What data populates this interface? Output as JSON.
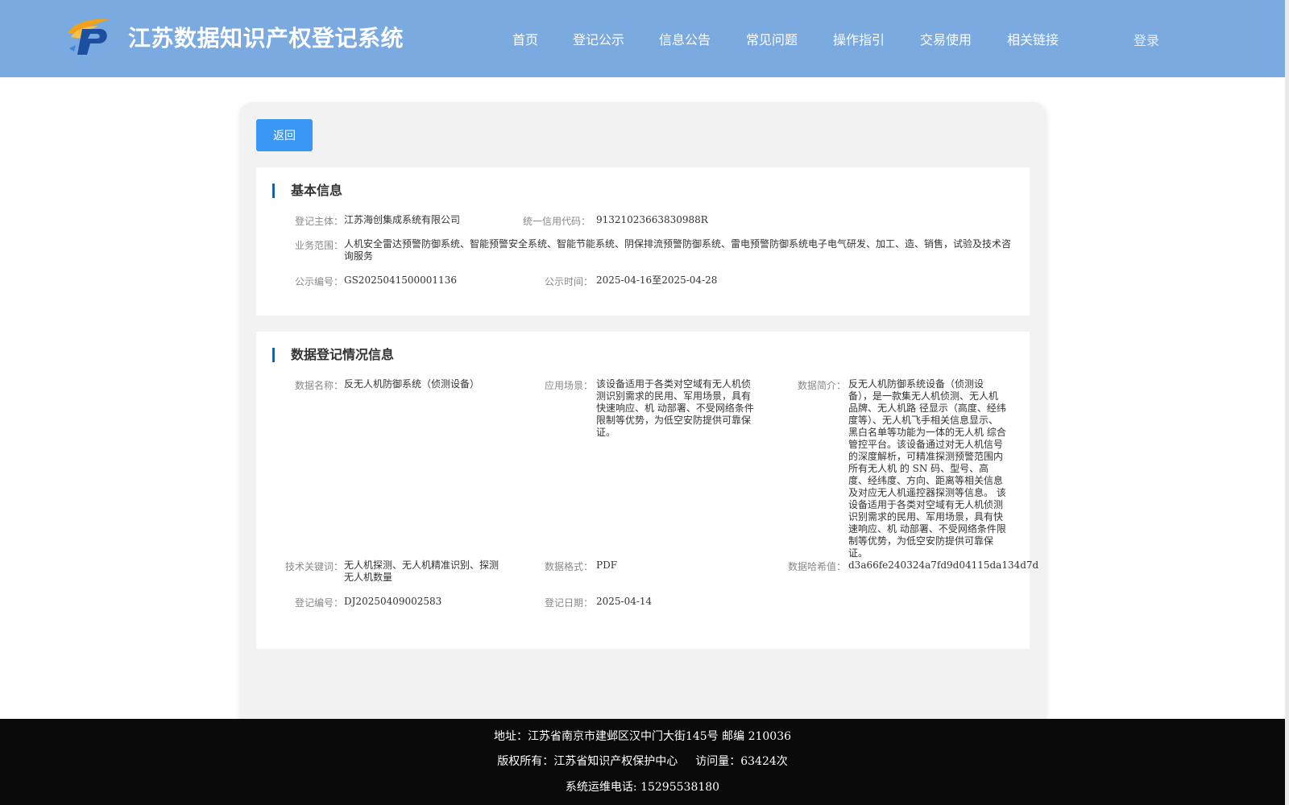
{
  "header": {
    "title": "江苏数据知识产权登记系统",
    "nav": [
      "首页",
      "登记公示",
      "信息公告",
      "常见问题",
      "操作指引",
      "交易使用",
      "相关链接"
    ],
    "login": "登录"
  },
  "back_label": "返回",
  "basic": {
    "title": "基本信息",
    "subject_label": "登记主体：",
    "subject": "江苏海创集成系统有限公司",
    "credit_label": "统一信用代码：",
    "credit": "91321023663830988R",
    "scope_label": "业务范围：",
    "scope": "人机安全雷达预警防御系统、智能预警安全系统、智能节能系统、阴保排流预警防御系统、雷电预警防御系统电子电气研发、加工、造、销售，试验及技术咨询服务",
    "notice_no_label": "公示编号：",
    "notice_no": "GS2025041500001136",
    "notice_time_label": "公示时间：",
    "notice_time": "2025-04-16至2025-04-28"
  },
  "data_info": {
    "title": "数据登记情况信息",
    "name_label": "数据名称：",
    "name": "反无人机防御系统（侦测设备）",
    "scene_label": "应用场景：",
    "scene": "该设备适用于各类对空域有无人机侦测识别需求的民用、军用场景，具有快速响应、机 动部署、不受网络条件限制等优势，为低空安防提供可靠保证。",
    "intro_label": "数据简介：",
    "intro": "反无人机防御系统设备（侦测设备），是一款集无人机侦测、无人机品牌、无人机路 径显示（高度、经纬度等）、无人机飞手相关信息显示、黑白名单等功能为一体的无人机 综合管控平台。该设备通过对无人机信号的深度解析，可精准探测预警范围内所有无人机 的 SN 码、型号、高度、经纬度、方向、距离等相关信息及对应无人机遥控器探测等信息。 该设备适用于各类对空域有无人机侦测识别需求的民用、军用场景，具有快速响应、机 动部署、不受网络条件限制等优势，为低空安防提供可靠保证。",
    "keywords_label": "技术关键词：",
    "keywords": "无人机探测、无人机精准识别、探测无人机数量",
    "format_label": "数据格式：",
    "format": "PDF",
    "hash_label": "数据哈希值：",
    "hash": "d3a66fe240324a7fd9d04115da134d7d",
    "reg_no_label": "登记编号：",
    "reg_no": "DJ20250409002583",
    "reg_date_label": "登记日期：",
    "reg_date": "2025-04-14"
  },
  "footer": {
    "address": "地址：江苏省南京市建邺区汉中门大街145号 邮编 210036",
    "copyright": "版权所有：江苏省知识产权保护中心",
    "visits": "访问量：63424次",
    "phone": "系统运维电话: 15295538180"
  },
  "colors": {
    "header_bg": "#7aaadf",
    "button_bg": "#3a97f6",
    "section_accent": "#1f5fa8",
    "footer_bg": "#0a0a0a"
  }
}
